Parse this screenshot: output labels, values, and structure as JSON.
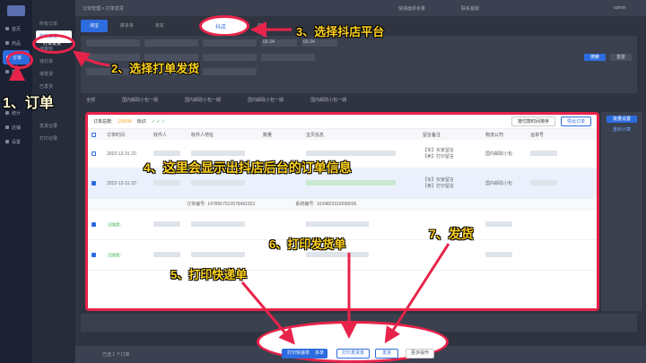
{
  "sidebar": {
    "items": [
      {
        "label": "首页",
        "active": false
      },
      {
        "label": "商品",
        "active": false
      },
      {
        "label": "订单",
        "active": true
      },
      {
        "label": "售后",
        "active": false
      },
      {
        "label": "统计",
        "active": false
      },
      {
        "label": "店铺",
        "active": false
      },
      {
        "label": "设置",
        "active": false
      }
    ]
  },
  "subnav": {
    "items": [
      {
        "label": "所有订单",
        "selected": false
      },
      {
        "label": "打单发货",
        "selected": true
      },
      {
        "label": "待审核",
        "selected": false
      },
      {
        "label": "待打单",
        "selected": false
      },
      {
        "label": "待发货",
        "selected": false
      },
      {
        "label": "已发货",
        "selected": false
      },
      {
        "label": "发货记录",
        "selected": false
      },
      {
        "label": "打印记录",
        "selected": false
      }
    ]
  },
  "topbar": {
    "left": "订单管理 > 打单发货",
    "right_a": "快递面单余量",
    "right_b": "联系客服",
    "user": "admin"
  },
  "platform_tabs": [
    {
      "label": "淘宝",
      "active": true
    },
    {
      "label": "拼多多",
      "active": false
    },
    {
      "label": "京东",
      "active": false
    },
    {
      "label": "抖店",
      "active": false,
      "circled": true
    },
    {
      "label": "快手",
      "active": false
    }
  ],
  "filters": {
    "search_label": "搜索",
    "reset_label": "重置",
    "date_a": "02-24",
    "date_b": "02-24"
  },
  "status_tabs": [
    "全部",
    "国内邮政小包一期",
    "国内邮政小包一期",
    "国内邮政小包一期",
    "国内邮政小包一期"
  ],
  "panel": {
    "order_total_label": "订单总数:",
    "order_total_value": "1/9999",
    "mark_label": "标识",
    "sort_label": "按付款时间排序",
    "export_label": "导出订单",
    "columns": [
      "订单时间",
      "收件人",
      "收件人地址",
      "数量",
      "宝贝信息",
      "留言备注",
      "物流公司",
      "运单号"
    ],
    "rows": [
      {
        "time": "2022-12-31 22:",
        "logistics": "国内邮政小包",
        "tag": "已发货",
        "highlight": false
      },
      {
        "time": "2022-12-31 22:",
        "logistics": "国内邮政小包",
        "tag": "已发货",
        "highlight": true
      },
      {
        "time": "",
        "logistics": "",
        "tag": "已发货",
        "highlight": false
      },
      {
        "time": "",
        "logistics": "",
        "tag": "已发货",
        "highlight": false
      }
    ],
    "meta_label_a": "订单编号:",
    "meta_value_a": "1478967912678491552",
    "meta_label_b": "系统编号:",
    "meta_value_b": "1034803316098036",
    "note_a": "【买】买家留言",
    "note_b": "【卖】打印留言"
  },
  "right_panel": {
    "btn_a": "批量设置",
    "btn_b": "重新计算"
  },
  "bottom_actions": {
    "print_express": "打印快递单",
    "more": "多单",
    "print_ship": "打印发货单",
    "ship": "发货",
    "more_ops": "更多操作",
    "selected": "已选 1 个订单"
  },
  "callouts": {
    "c1": "1、订单",
    "c2": "2、选择打单发货",
    "c3": "3、选择抖店平台",
    "c4": "4、这里会显示出抖店后台的订单信息",
    "c5": "5、打印快递单",
    "c6": "6、打印发货单",
    "c7": "7、发货"
  },
  "colors": {
    "accent": "#2d6cdf",
    "annotation": "#e8234a",
    "callout_text": "#ffd21e"
  }
}
